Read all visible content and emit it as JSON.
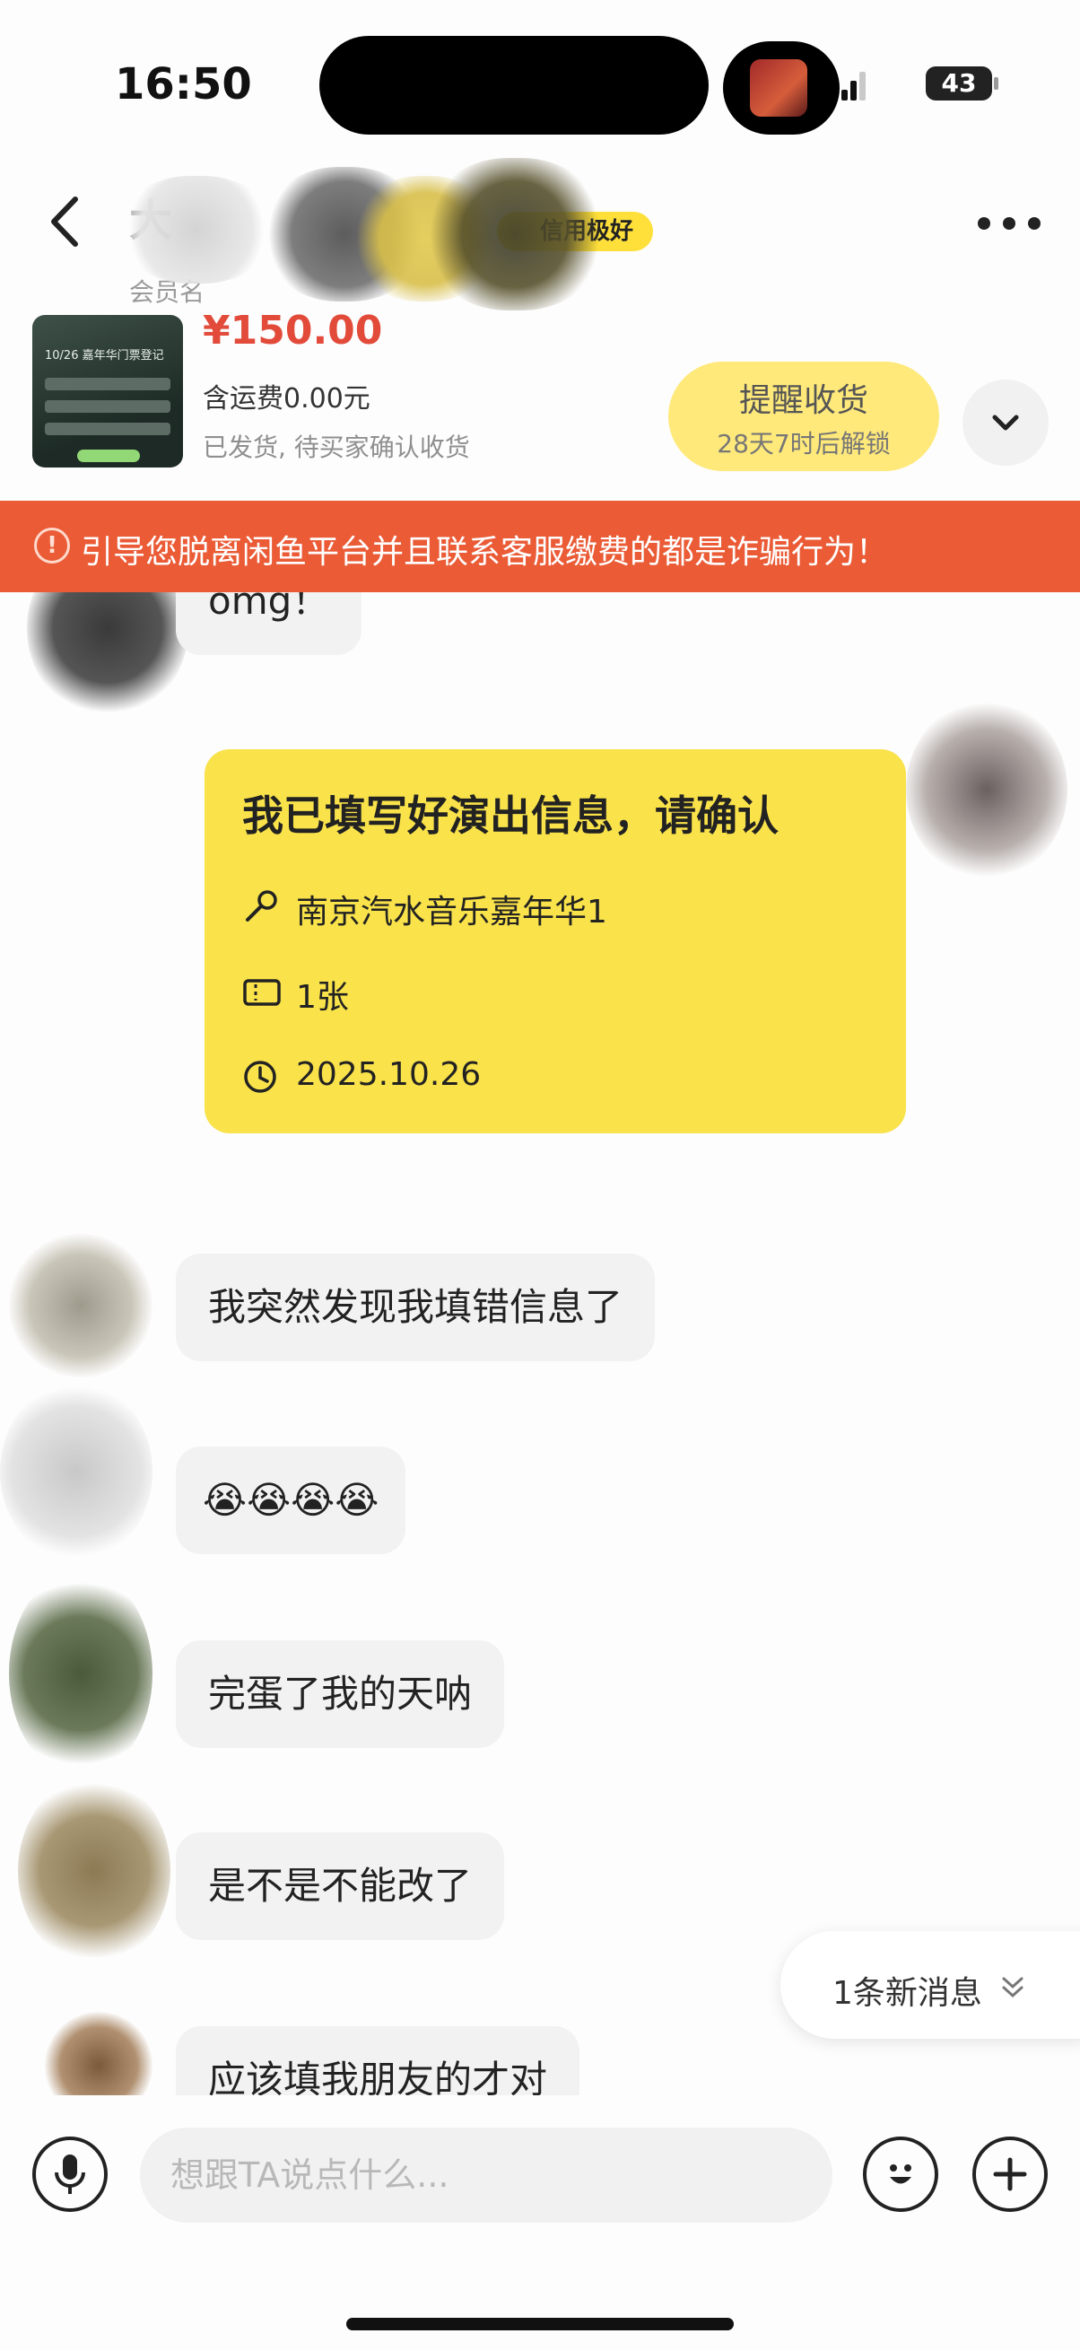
{
  "status_bar": {
    "time": "16:50",
    "battery": "43"
  },
  "header": {
    "peer_name": "大",
    "peer_subtitle": "会员名",
    "credit_badge": "信用极好"
  },
  "order": {
    "price": "¥150.00",
    "shipping": "含运费0.00元",
    "status": "已发货, 待买家确认收货",
    "thumb_title": "10/26 嘉年华门票登记",
    "remind_button_label": "提醒收货",
    "remind_button_sub": "28天7时后解锁"
  },
  "warning": {
    "icon": "!",
    "text": "引导您脱离闲鱼平台并且联系客服缴费的都是诈骗行为！"
  },
  "messages": {
    "m0": "omg！",
    "form_card": {
      "title": "我已填写好演出信息，请确认",
      "event_icon": "microphone-icon",
      "event": "南京汽水音乐嘉年华1",
      "ticket_icon": "ticket-icon",
      "tickets": "1张",
      "date_icon": "clock-icon",
      "date": "2025.10.26"
    },
    "m1": "我突然发现我填错信息了",
    "m2": "😭😭😭😭",
    "m3": "完蛋了我的天呐",
    "m4": "是不是不能改了",
    "m5": "应该填我朋友的才对"
  },
  "new_messages_pill": "1条新消息",
  "input": {
    "placeholder": "想跟TA说点什么..."
  },
  "colors": {
    "accent_yellow": "#f9e24a",
    "price_red": "#e24b3a",
    "warning_orange": "#ea5b36"
  }
}
